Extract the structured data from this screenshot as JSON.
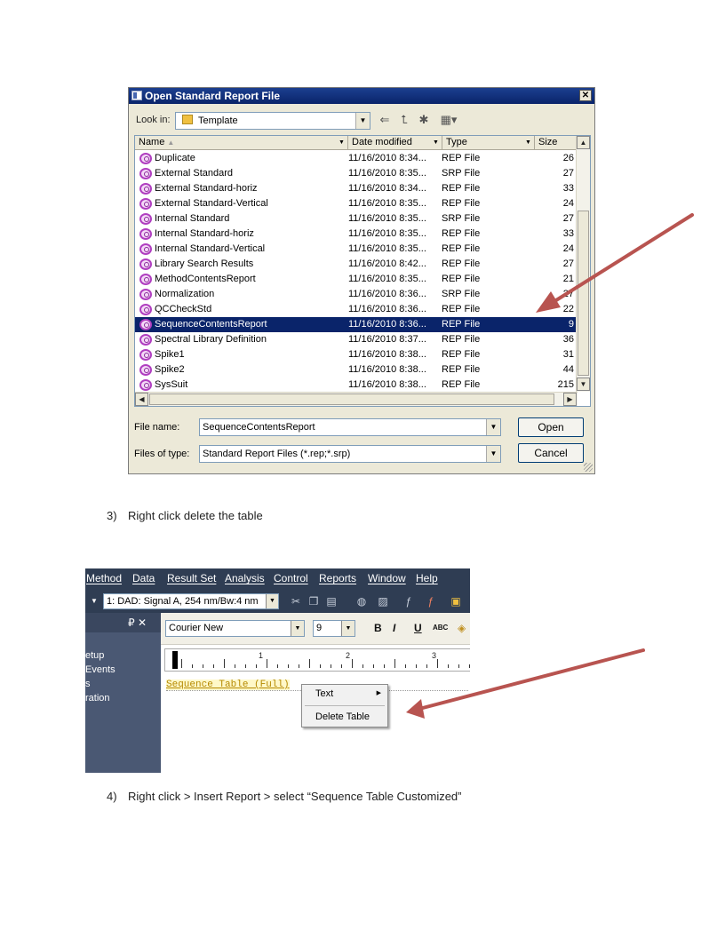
{
  "dialog": {
    "title": "Open Standard Report File",
    "close_glyph": "✕",
    "look_in_label": "Look in:",
    "look_in_value": "Template",
    "columns": [
      "Name",
      "Date modified",
      "Type",
      "Size"
    ],
    "files": [
      {
        "name": "Duplicate",
        "date": "11/16/2010 8:34...",
        "type": "REP File",
        "size": "26",
        "selected": false
      },
      {
        "name": "External Standard",
        "date": "11/16/2010 8:35...",
        "type": "SRP File",
        "size": "27",
        "selected": false
      },
      {
        "name": "External Standard-horiz",
        "date": "11/16/2010 8:34...",
        "type": "REP File",
        "size": "33",
        "selected": false
      },
      {
        "name": "External Standard-Vertical",
        "date": "11/16/2010 8:35...",
        "type": "REP File",
        "size": "24",
        "selected": false
      },
      {
        "name": "Internal Standard",
        "date": "11/16/2010 8:35...",
        "type": "SRP File",
        "size": "27",
        "selected": false
      },
      {
        "name": "Internal Standard-horiz",
        "date": "11/16/2010 8:35...",
        "type": "REP File",
        "size": "33",
        "selected": false
      },
      {
        "name": "Internal Standard-Vertical",
        "date": "11/16/2010 8:35...",
        "type": "REP File",
        "size": "24",
        "selected": false
      },
      {
        "name": "Library Search Results",
        "date": "11/16/2010 8:42...",
        "type": "REP File",
        "size": "27",
        "selected": false
      },
      {
        "name": "MethodContentsReport",
        "date": "11/16/2010 8:35...",
        "type": "REP File",
        "size": "21",
        "selected": false
      },
      {
        "name": "Normalization",
        "date": "11/16/2010 8:36...",
        "type": "SRP File",
        "size": "27",
        "selected": false
      },
      {
        "name": "QCCheckStd",
        "date": "11/16/2010 8:36...",
        "type": "REP File",
        "size": "22",
        "selected": false
      },
      {
        "name": "SequenceContentsReport",
        "date": "11/16/2010 8:36...",
        "type": "REP File",
        "size": "9",
        "selected": true
      },
      {
        "name": "Spectral Library Definition",
        "date": "11/16/2010 8:37...",
        "type": "REP File",
        "size": "36",
        "selected": false
      },
      {
        "name": "Spike1",
        "date": "11/16/2010 8:38...",
        "type": "REP File",
        "size": "31",
        "selected": false
      },
      {
        "name": "Spike2",
        "date": "11/16/2010 8:38...",
        "type": "REP File",
        "size": "44",
        "selected": false
      },
      {
        "name": "SysSuit",
        "date": "11/16/2010 8:38...",
        "type": "REP File",
        "size": "215",
        "selected": false
      }
    ],
    "file_name_label": "File name:",
    "file_name_value": "SequenceContentsReport",
    "files_of_type_label": "Files of type:",
    "files_of_type_value": "Standard Report Files (*.rep;*.srp)",
    "open_label": "Open",
    "cancel_label": "Cancel"
  },
  "steps": {
    "step3_num": "3)",
    "step3_text": "Right click delete the table",
    "step4_num": "4)",
    "step4_text": "Right click > Insert Report  > select “Sequence Table Customized”"
  },
  "app": {
    "menus": [
      "Method",
      "Data",
      "Result Set",
      "Analysis",
      "Control",
      "Reports",
      "Window",
      "Help"
    ],
    "signal_value": "1: DAD: Signal A, 254 nm/Bw:4 nm",
    "panel_controls": "₽ ✕",
    "side_items": [
      "etup",
      "Events",
      "s",
      "ration"
    ],
    "font_value": "Courier New",
    "font_size_value": "9",
    "bold_label": "B",
    "italic_label": "I",
    "underline_label": "U",
    "spell_label": "ABC",
    "ruler_numbers": [
      "1",
      "2",
      "3"
    ],
    "sequence_text": "Sequence Table (Full)",
    "context_menu": {
      "text_label": "Text",
      "delete_label": "Delete Table"
    }
  },
  "colors": {
    "arrow": "#b85450",
    "selection": "#0a246a",
    "app_bar": "#2f3d53"
  }
}
